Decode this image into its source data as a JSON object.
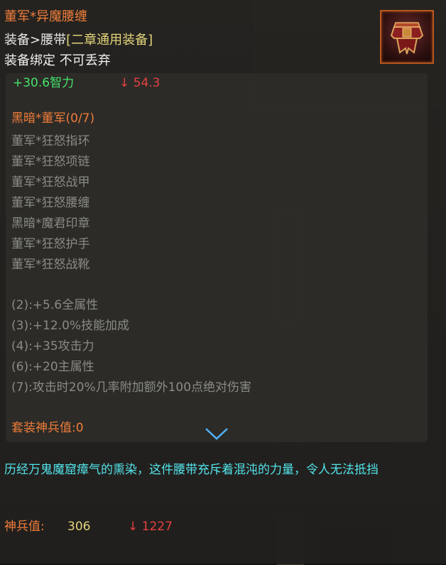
{
  "item": {
    "name": "董军*异魔腰缠",
    "type_prefix": "装备>腰带",
    "type_tag": "[二章通用装备]",
    "binding": "装备绑定 不可丢弃",
    "icon": "belt-icon"
  },
  "stats": {
    "main_stat": "+30.6智力",
    "compare_diff": "↓ 54.3"
  },
  "set": {
    "title": "黑暗*董军(0/7)",
    "pieces": [
      "董军*狂怒指环",
      "董军*狂怒项链",
      "董军*狂怒战甲",
      "董军*狂怒腰缠",
      "黑暗*魔君印章",
      "董军*狂怒护手",
      "董军*狂怒战靴"
    ],
    "bonuses": [
      "(2):+5.6全属性",
      "(3):+12.0%技能加成",
      "(4):+35攻击力",
      "(6):+20主属性",
      "(7):攻击时20%几率附加额外100点绝对伤害"
    ],
    "set_power": "套装神兵值:0"
  },
  "description": "历经万鬼魔窟瘴气的熏染，这件腰带充斥着混沌的力量，令人无法抵挡",
  "power": {
    "label": "神兵值:",
    "value": "306",
    "compare_diff": "↓ 1227"
  },
  "colors": {
    "title_orange": "#ef7d3a",
    "tag_yellow": "#e2d37a",
    "stat_green": "#44e36a",
    "down_red": "#e54040",
    "inactive_gray": "#8a8a86",
    "description_cyan": "#52e3ea"
  }
}
